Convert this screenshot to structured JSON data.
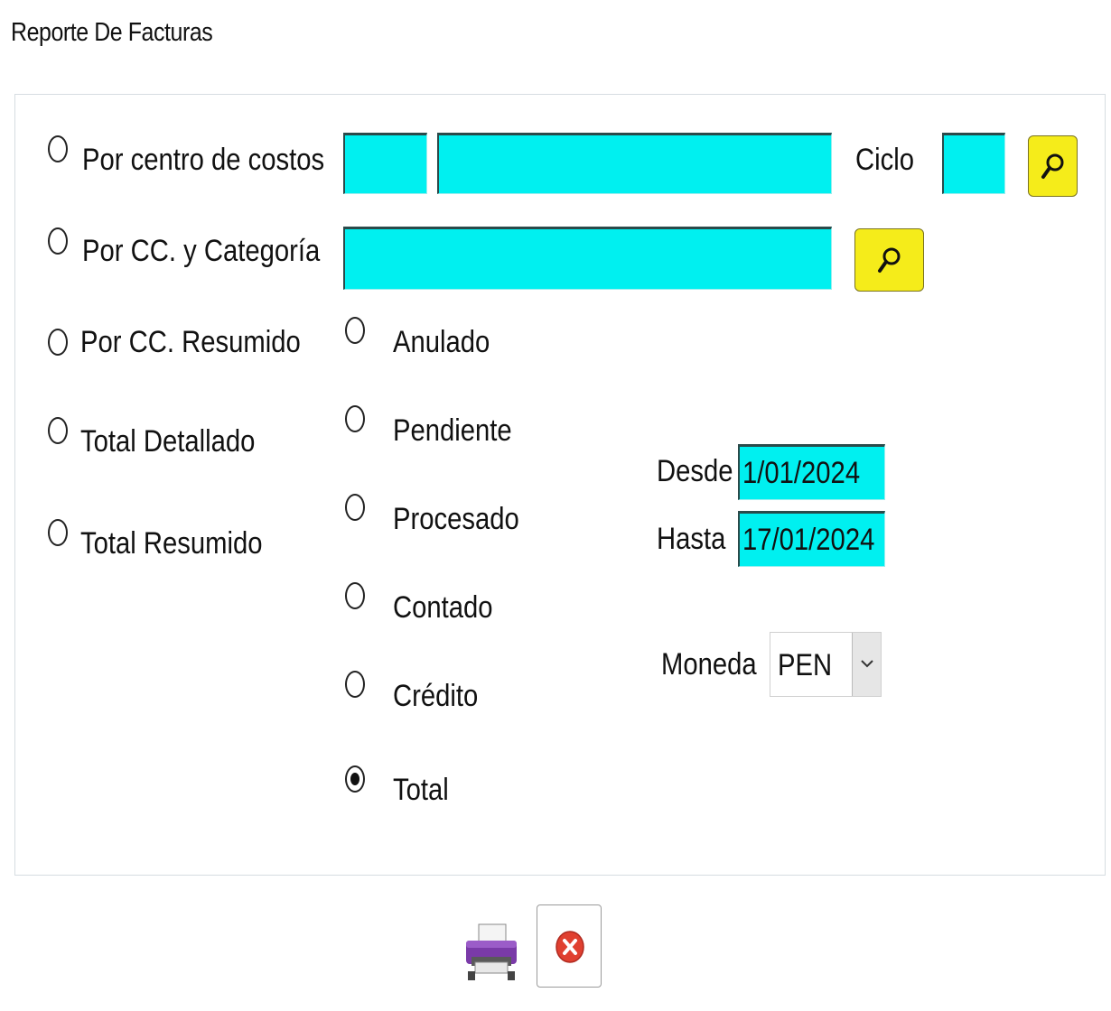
{
  "window": {
    "title": "Reporte De Facturas"
  },
  "report_type": {
    "options": [
      {
        "label": "Por centro de costos",
        "selected": false
      },
      {
        "label": "Por CC. y Categoría",
        "selected": false
      },
      {
        "label": "Por CC. Resumido",
        "selected": false
      },
      {
        "label": "Total Detallado",
        "selected": false
      },
      {
        "label": "Total Resumido",
        "selected": false
      }
    ]
  },
  "filters": {
    "cost_center_code": "",
    "cost_center_name": "",
    "ciclo_label": "Ciclo",
    "ciclo_value": "",
    "category_value": ""
  },
  "status": {
    "options": [
      {
        "label": "Anulado",
        "selected": false
      },
      {
        "label": "Pendiente",
        "selected": false
      },
      {
        "label": "Procesado",
        "selected": false
      },
      {
        "label": "Contado",
        "selected": false
      },
      {
        "label": "Crédito",
        "selected": false
      },
      {
        "label": "Total",
        "selected": true
      }
    ]
  },
  "dates": {
    "from_label": "Desde",
    "from_value": "1/01/2024",
    "to_label": "Hasta",
    "to_value": "17/01/2024"
  },
  "currency": {
    "label": "Moneda",
    "value": "PEN"
  },
  "icons": {
    "search": "magnifier-icon",
    "print": "printer-icon",
    "close": "close-circle-icon",
    "dropdown": "chevron-down-icon"
  },
  "colors": {
    "input_bg": "#00f0f0",
    "search_button_bg": "#f5ec1a",
    "close_icon": "#e04030",
    "printer_accent": "#7a3aa8"
  }
}
